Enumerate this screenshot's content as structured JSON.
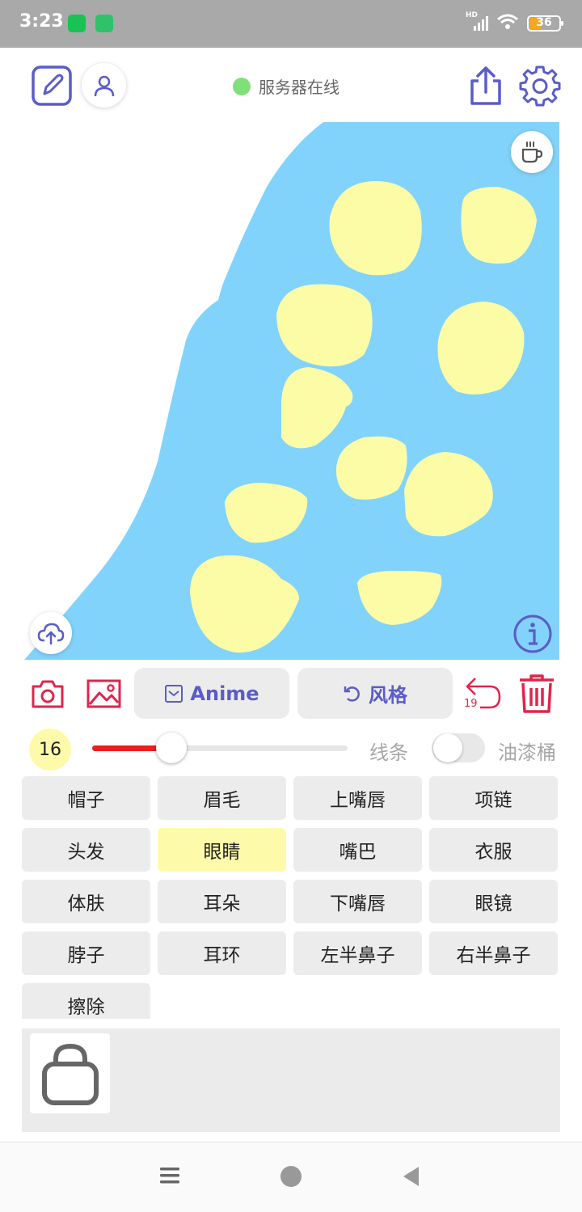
{
  "status_bar": {
    "time": "3:23",
    "network": "HD",
    "battery": "36",
    "battery_level": 0.36
  },
  "header": {
    "server_status": "服务器在线",
    "server_status_color": "#7fe07a",
    "accent_color": "#5a5cc8"
  },
  "canvas": {
    "background_color": "#82d3fb",
    "spot_color": "#fdfca6"
  },
  "toolbar": {
    "anime_label": "Anime",
    "style_label": "风格",
    "undo_count": "19",
    "action_color": "#e0254d"
  },
  "brush": {
    "size": "16",
    "size_fraction": 0.31,
    "line_label": "线条",
    "bucket_label": "油漆桶",
    "bucket_enabled": false
  },
  "parts": [
    {
      "label": "帽子",
      "selected": false
    },
    {
      "label": "眉毛",
      "selected": false
    },
    {
      "label": "上嘴唇",
      "selected": false
    },
    {
      "label": "项链",
      "selected": false
    },
    {
      "label": "头发",
      "selected": false
    },
    {
      "label": "眼睛",
      "selected": true
    },
    {
      "label": "嘴巴",
      "selected": false
    },
    {
      "label": "衣服",
      "selected": false
    },
    {
      "label": "体肤",
      "selected": false
    },
    {
      "label": "耳朵",
      "selected": false
    },
    {
      "label": "下嘴唇",
      "selected": false
    },
    {
      "label": "眼镜",
      "selected": false
    },
    {
      "label": "脖子",
      "selected": false
    },
    {
      "label": "耳环",
      "selected": false
    },
    {
      "label": "左半鼻子",
      "selected": false
    },
    {
      "label": "右半鼻子",
      "selected": false
    },
    {
      "label": "擦除",
      "selected": false
    }
  ]
}
